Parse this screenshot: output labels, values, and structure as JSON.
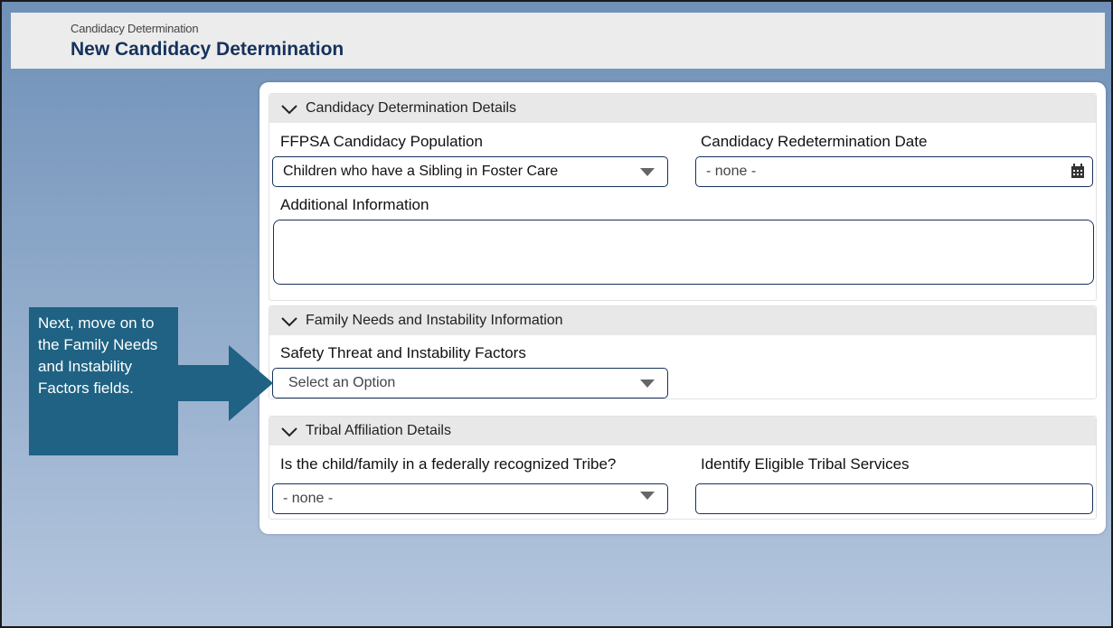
{
  "header": {
    "breadcrumb": "Candidacy Determination",
    "title": "New Candidacy Determination"
  },
  "sections": {
    "details": {
      "title": "Candidacy Determination Details",
      "population_label": "FFPSA Candidacy Population",
      "population_value": "Children who have a Sibling in Foster Care",
      "redetermination_label": "Candidacy Redetermination Date",
      "redetermination_value": "- none -",
      "additional_label": "Additional Information",
      "additional_value": ""
    },
    "family": {
      "title": "Family Needs and Instability Information",
      "safety_label": "Safety Threat and Instability Factors",
      "safety_placeholder": "Select an Option"
    },
    "tribal": {
      "title": "Tribal Affiliation Details",
      "tribe_label": "Is the child/family in a federally recognized Tribe?",
      "tribe_value": "- none -",
      "services_label": "Identify Eligible Tribal Services",
      "services_value": ""
    }
  },
  "callout": {
    "text": "Next, move on to the Family Needs and Instability Factors fields."
  },
  "colors": {
    "callout_bg": "#1f6283",
    "title_color": "#16325c",
    "field_border": "#16325c"
  }
}
